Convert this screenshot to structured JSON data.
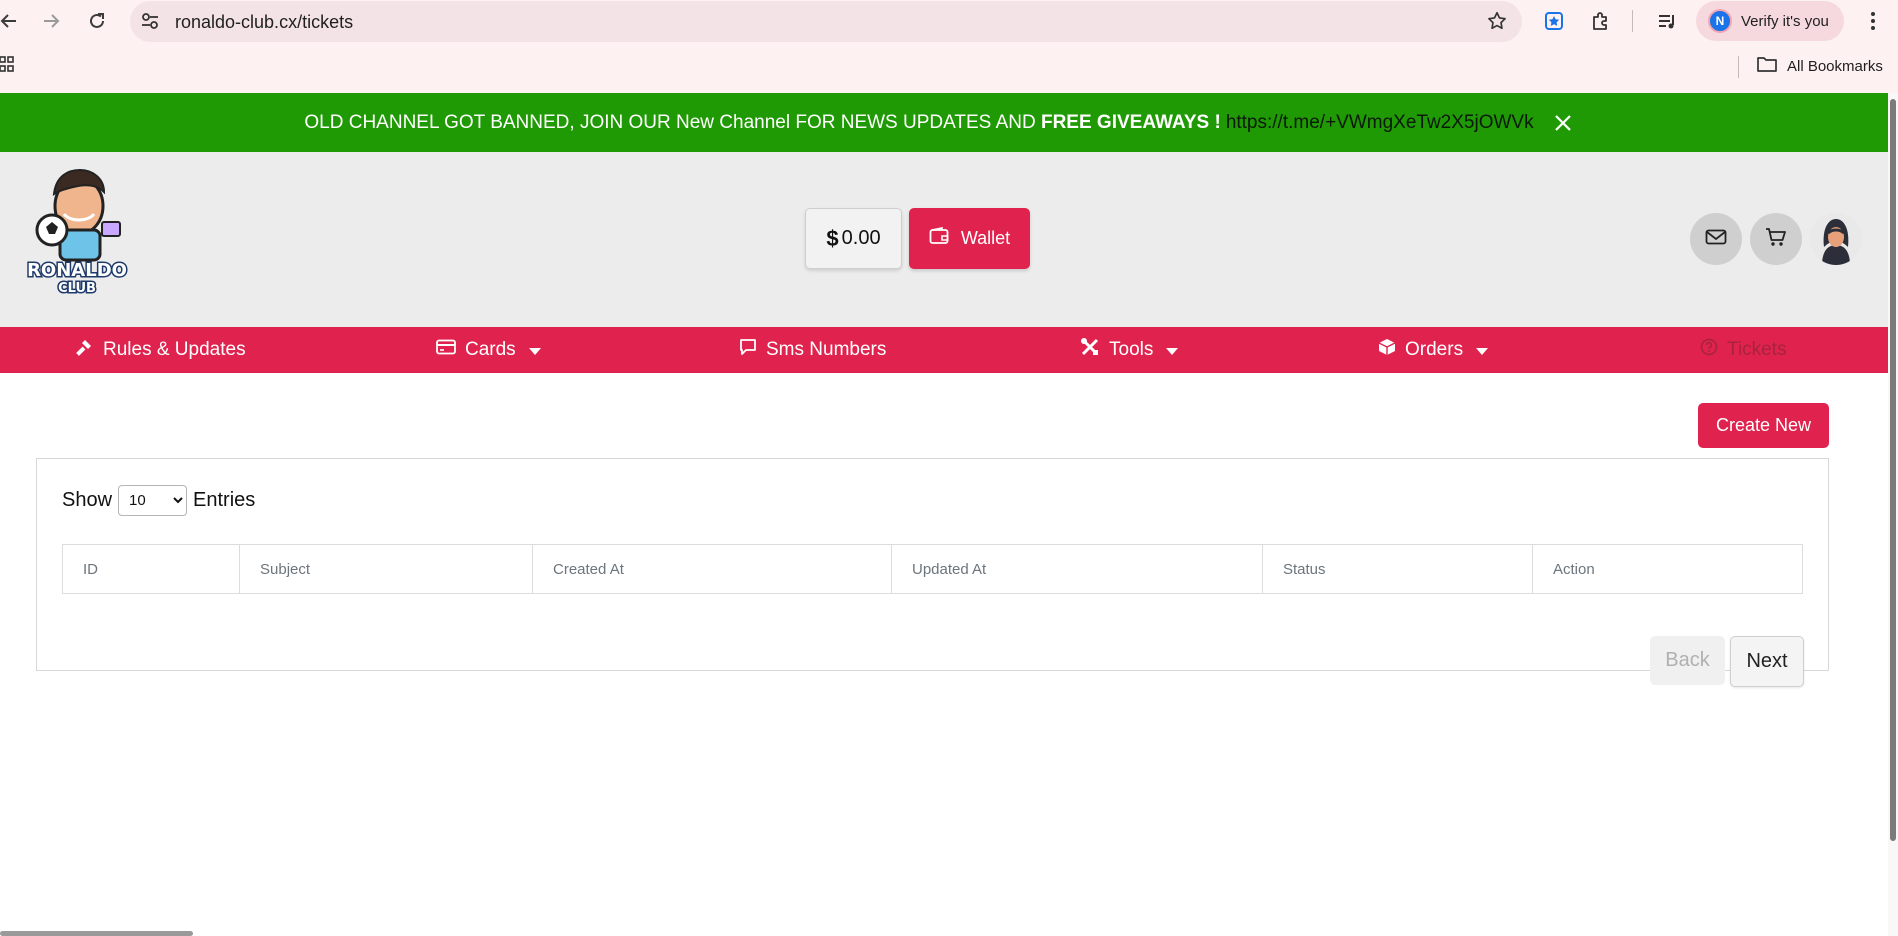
{
  "browser": {
    "url": "ronaldo-club.cx/tickets",
    "profile_label": "Verify it's you",
    "profile_initial": "N",
    "bookmarks_label": "All Bookmarks"
  },
  "announcement": {
    "text_1": "OLD CHANNEL GOT BANNED, JOIN OUR New Channel FOR NEWS UPDATES AND ",
    "text_bold": "FREE GIVEAWAYS !",
    "link": "https://t.me/+VWmgXeTw2X5jOWVk",
    "background": "#1f9a04"
  },
  "header": {
    "logo_text_1": "RONALDO",
    "logo_text_2": "CLUB",
    "balance": "0.00",
    "currency": "$",
    "wallet_label": "Wallet"
  },
  "nav": {
    "items": [
      {
        "label": "Rules & Updates",
        "icon": "hammer-icon"
      },
      {
        "label": "Cards",
        "icon": "credit-card-icon",
        "dropdown": true
      },
      {
        "label": "Sms Numbers",
        "icon": "chat-icon"
      },
      {
        "label": "Tools",
        "icon": "tools-icon",
        "dropdown": true
      },
      {
        "label": "Orders",
        "icon": "box-icon",
        "dropdown": true
      },
      {
        "label": "Tickets",
        "icon": "question-circle-icon",
        "active": true
      }
    ],
    "background": "#e0234e"
  },
  "tickets": {
    "create_label": "Create New",
    "show_label": "Show",
    "entries_label": "Entries",
    "page_size": "10",
    "page_size_options": [
      "10"
    ],
    "columns": [
      "ID",
      "Subject",
      "Created At",
      "Updated At",
      "Status",
      "Action"
    ],
    "rows": [],
    "back_label": "Back",
    "next_label": "Next"
  }
}
